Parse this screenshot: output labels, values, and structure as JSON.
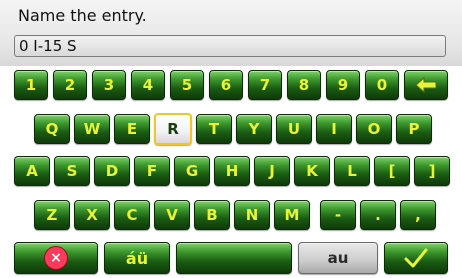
{
  "prompt": "Name the entry.",
  "entry_value": "0 I-15 S",
  "keyboard": {
    "row1": [
      "1",
      "2",
      "3",
      "4",
      "5",
      "6",
      "7",
      "8",
      "9",
      "0"
    ],
    "row2": [
      "Q",
      "W",
      "E",
      "R",
      "T",
      "Y",
      "U",
      "I",
      "O",
      "P"
    ],
    "row3": [
      "A",
      "S",
      "D",
      "F",
      "G",
      "H",
      "J",
      "K",
      "L",
      "[",
      "]"
    ],
    "row4": [
      "Z",
      "X",
      "C",
      "V",
      "B",
      "N",
      "M",
      "-",
      ".",
      ","
    ],
    "selected_key": "R",
    "bottom": {
      "accent_label": "áü",
      "mode_label": "au"
    }
  },
  "icons": {
    "backspace": "left-arrow-icon",
    "delete": "red-x-icon",
    "done": "checkmark-icon"
  },
  "colors": {
    "key_text": "#e8f33a",
    "selected_border": "#f0c62a",
    "delete_red": "#ff3a5a",
    "key_green_dark": "#0f3a0a",
    "key_green_light": "#7fd36a"
  }
}
